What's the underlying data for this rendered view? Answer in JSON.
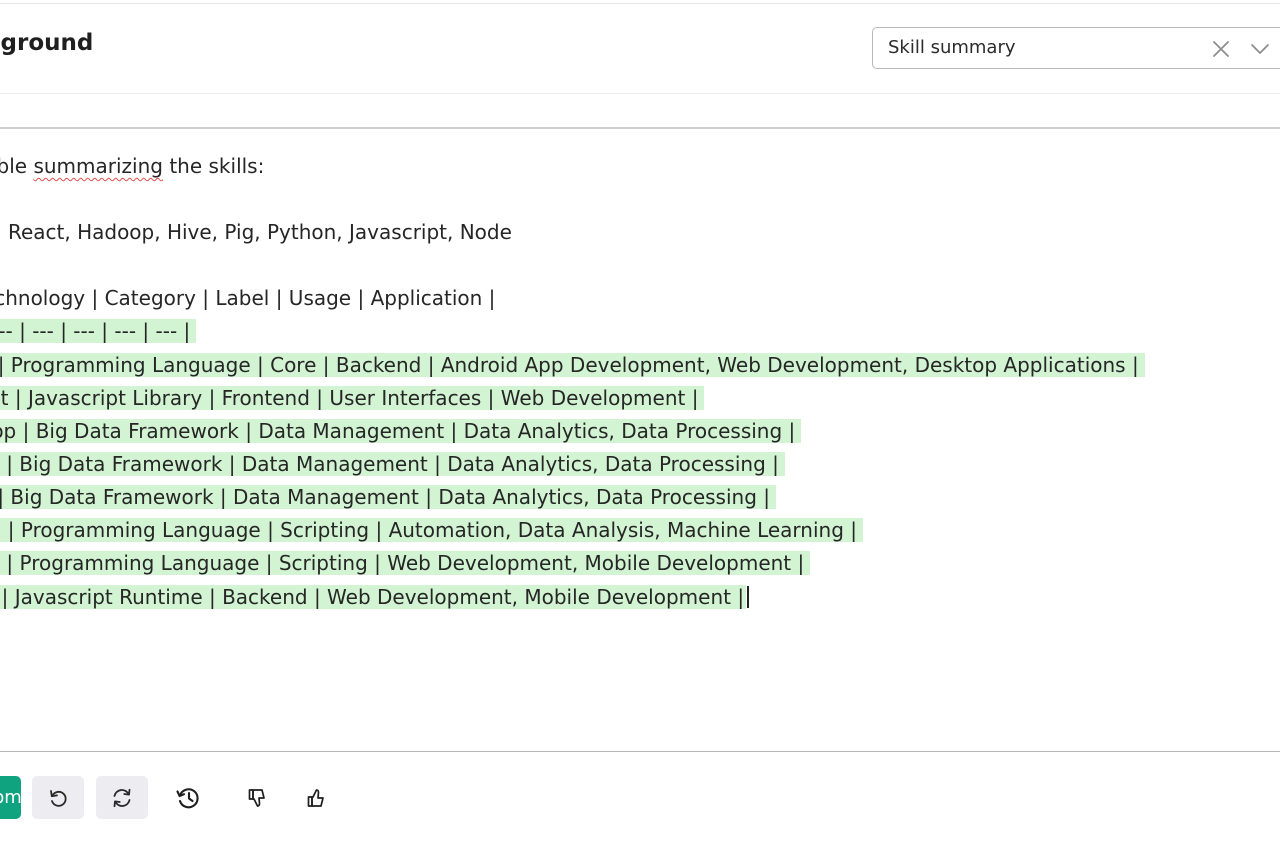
{
  "header": {
    "title": "Playground",
    "preset": {
      "selected": "Skill summary"
    }
  },
  "editor": {
    "lines": [
      "Create a table summarizing the skills:",
      "Java, React, Hadoop, Hive, Pig, Python, Javascript, Node",
      "| Technology | Category | Label | Usage | Application |",
      "| --- | --- | --- | --- | --- |",
      "| Java | Programming Language | Core | Backend | Android App Development, Web Development, Desktop Applications |",
      "| React | Javascript Library | Frontend | User Interfaces | Web Development |",
      "| Hadoop | Big Data Framework | Data Management | Data Analytics, Data Processing |",
      "| Hive | Big Data Framework | Data Management | Data Analytics, Data Processing |",
      "| Pig | Big Data Framework | Data Management | Data Analytics, Data Processing |",
      "| Python | Programming Language | Scripting | Automation, Data Analysis, Machine Learning |",
      "| Javascript | Programming Language | Scripting | Web Development, Mobile Development |",
      "| Node | Javascript Runtime | Backend | Web Development, Mobile Development |"
    ],
    "prompt_split": {
      "prefix": "Create a table ",
      "misspelled": "summarizing",
      "suffix": " the skills:"
    }
  },
  "toolbar": {
    "submit_label": "Submit",
    "icons": [
      "undo-icon",
      "regenerate-icon",
      "history-icon",
      "thumbs-down-icon",
      "thumbs-up-icon"
    ]
  },
  "colors": {
    "accent": "#10a37f",
    "highlight": "#d2f4d3",
    "spellcheck": "#e04b4b"
  }
}
